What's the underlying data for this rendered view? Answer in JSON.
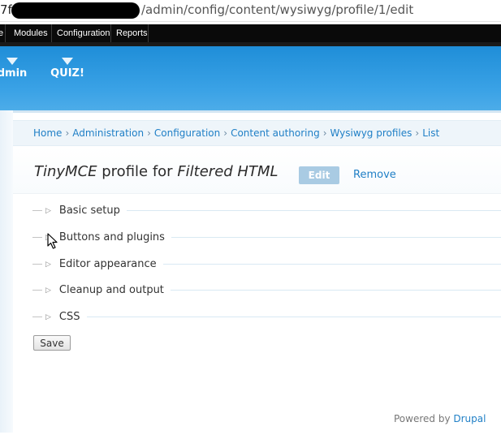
{
  "browser": {
    "url_prefix": "7f",
    "url_path": "/admin/config/content/wysiwyg/profile/1/edit"
  },
  "toolbar": {
    "items": [
      "e",
      "Modules",
      "Configuration",
      "Reports"
    ]
  },
  "header": {
    "shortcuts": [
      "dmin",
      "QUIZ!"
    ]
  },
  "breadcrumb": [
    "Home",
    "Administration",
    "Configuration",
    "Content authoring",
    "Wysiwyg profiles",
    "List"
  ],
  "page": {
    "title_editor": "TinyMCE",
    "title_middle": " profile for ",
    "title_format": "Filtered HTML",
    "tabs": {
      "edit": "Edit",
      "remove": "Remove"
    }
  },
  "fieldsets": [
    "Basic setup",
    "Buttons and plugins",
    "Editor appearance",
    "Cleanup and output",
    "CSS"
  ],
  "form": {
    "save_label": "Save"
  },
  "footer": {
    "prefix": "Powered by ",
    "link": "Drupal"
  },
  "colors": {
    "accent": "#1f7fc6",
    "header": "#2a98e0",
    "tab_active": "#a9cbe3"
  }
}
